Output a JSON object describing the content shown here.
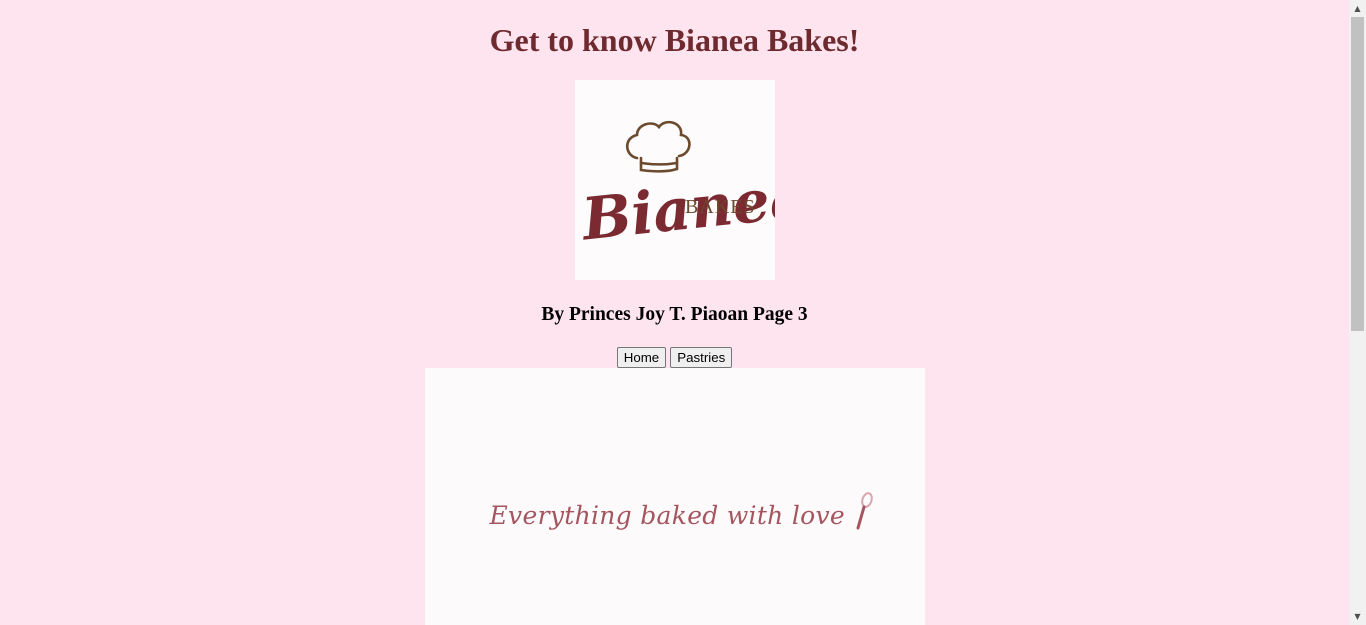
{
  "header": {
    "title": "Get to know Bianea Bakes!"
  },
  "logo": {
    "script_text": "Bianea",
    "sub_text": "BAKES",
    "icon": "chef-hat-icon"
  },
  "byline": "By Princes Joy T. Piaoan Page 3",
  "nav": {
    "home_label": "Home",
    "pastries_label": "Pastries"
  },
  "banner": {
    "text": "Everything baked with love",
    "icon": "whisk-icon"
  },
  "colors": {
    "background": "#fde4ef",
    "title": "#6e2a2e",
    "logo_maroon": "#7b2a31",
    "logo_brown": "#6b4a2e",
    "banner_text": "#a4555f"
  }
}
